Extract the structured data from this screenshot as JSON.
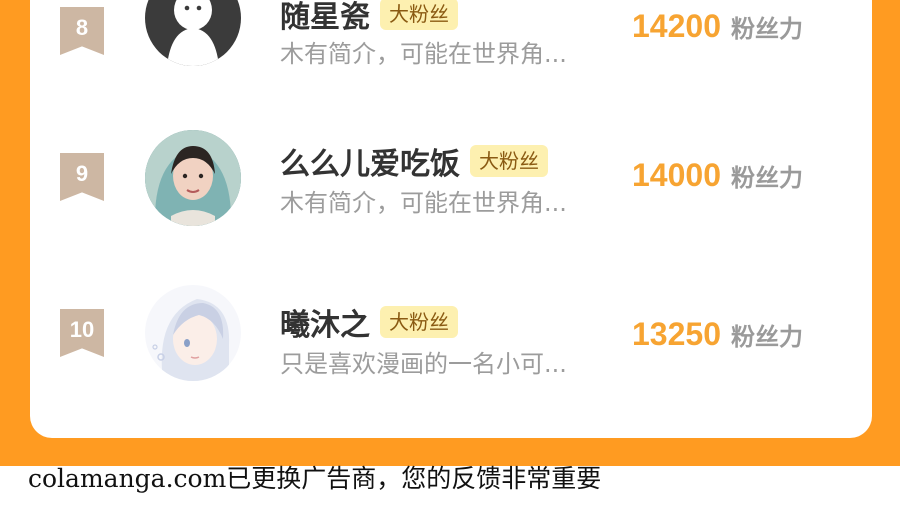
{
  "ranking": {
    "fan_power_unit": "粉丝力",
    "fan_badge_label": "大粉丝",
    "entries": [
      {
        "rank": "8",
        "name": "随星瓷",
        "badge": "大粉丝",
        "bio": "木有简介，可能在世界角...",
        "score": "14200",
        "avatar": "default-ghost-avatar"
      },
      {
        "rank": "9",
        "name": "么么儿爱吃饭",
        "badge": "大粉丝",
        "bio": "木有简介，可能在世界角...",
        "score": "14000",
        "avatar": "photo-girl-hood-avatar"
      },
      {
        "rank": "10",
        "name": "曦沐之",
        "badge": "大粉丝",
        "bio": "只是喜欢漫画的一名小可...",
        "score": "13250",
        "avatar": "anime-girl-avatar"
      }
    ]
  },
  "footer": {
    "notice": "colamanga.com已更换广告商，您的反馈非常重要"
  },
  "colors": {
    "panel_orange": "#ff9b21",
    "score_orange": "#f7a432",
    "badge_bg": "#fdf0b0",
    "rank_badge": "#cdb7a3"
  }
}
